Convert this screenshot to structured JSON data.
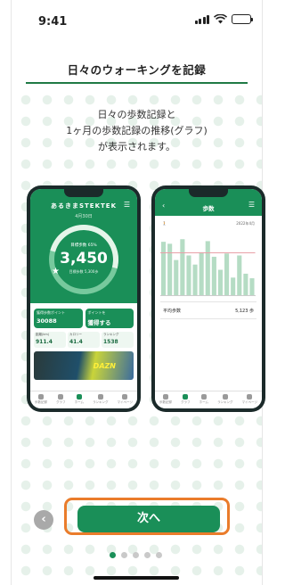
{
  "status": {
    "time": "9:41"
  },
  "header": {
    "title": "日々のウォーキングを記録"
  },
  "description": {
    "lines": [
      "日々の歩数記録と",
      "1ヶ月の歩数記録の推移(グラフ)",
      "が表示されます。"
    ]
  },
  "phone_home": {
    "brand": "あるきまSTEKTEK",
    "date": "4月30日",
    "goal": "目標歩数 65%",
    "steps": "3,450",
    "steps_sub": "目標歩数 5,300歩",
    "cards": [
      {
        "label": "獲得歩数ポイント",
        "value": "30088"
      },
      {
        "label": "ポイントを",
        "value": "獲得する"
      }
    ],
    "stats": [
      {
        "label": "距離(km)",
        "value": "911.4"
      },
      {
        "label": "カロリー",
        "value": "41.4"
      },
      {
        "label": "ランキング",
        "value": "1538"
      }
    ],
    "banner_text": "DAZN",
    "tabs": [
      "歩数記録",
      "グラフ",
      "ホーム",
      "ランキング",
      "マイページ"
    ]
  },
  "phone_graph": {
    "title": "歩数",
    "period": "2022年4月",
    "average_label": "平均歩数",
    "average_value": "5,123",
    "average_unit": "歩"
  },
  "chart_data": {
    "type": "bar",
    "categories": [
      "1",
      "2",
      "3",
      "4",
      "5",
      "6",
      "7",
      "8",
      "9",
      "10",
      "11",
      "12",
      "13",
      "14",
      "15"
    ],
    "values": [
      8200,
      7900,
      5400,
      8600,
      6100,
      4700,
      6600,
      8300,
      5900,
      3900,
      6400,
      2700,
      6100,
      3300,
      2600
    ],
    "reference_line": 6500,
    "ylim": [
      0,
      10000
    ]
  },
  "controls": {
    "back_glyph": "‹",
    "next_label": "次へ"
  },
  "pager": {
    "total": 5,
    "current": 0
  },
  "colors": {
    "primary": "#1a8f58",
    "highlight": "#ea7c2b",
    "accent_line": "#e8a0a8"
  }
}
